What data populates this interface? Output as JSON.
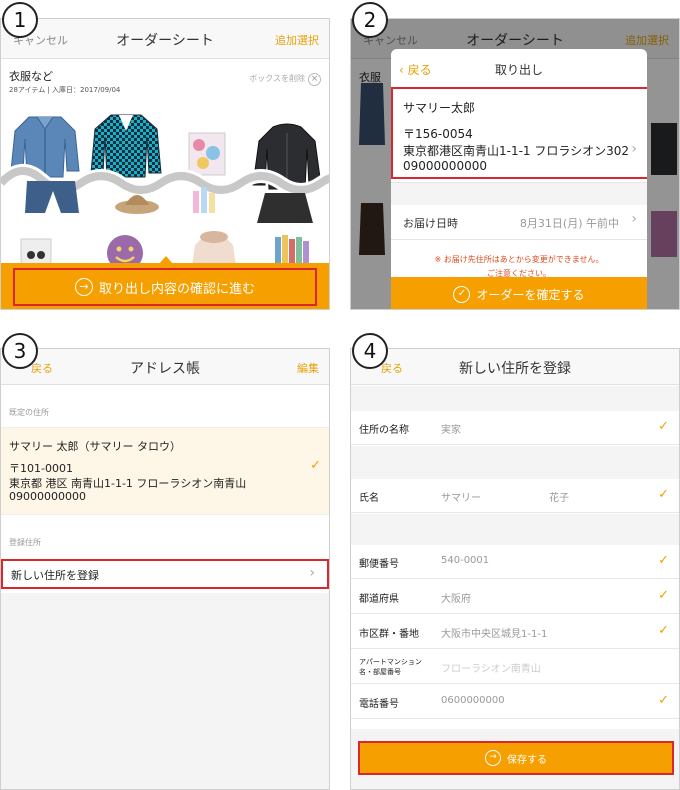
{
  "steps": [
    "1",
    "2",
    "3",
    "4"
  ],
  "screen1": {
    "nav": {
      "left": "キャンセル",
      "title": "オーダーシート",
      "right": "追加選択"
    },
    "box_title": "衣服など",
    "box_meta": "28アイテム | 入庫日：2017/09/04",
    "box_delete": "ボックスを削除",
    "cta": "取り出し内容の確認に進む"
  },
  "screen2": {
    "nav": {
      "left": "キャンセル",
      "title": "オーダーシート",
      "right": "追加選択"
    },
    "modal_back": "戻る",
    "modal_title": "取り出し",
    "address": {
      "name": "サマリー太郎",
      "zip": "〒156-0054",
      "line": "東京都港区南青山1-1-1 フロラシオン302",
      "phone": "09000000000"
    },
    "delivery_label": "お届け日時",
    "delivery_value": "8月31日(月) 午前中",
    "notice_1": "※ お届け先住所はあとから変更ができません。",
    "notice_2": "ご注意ください。",
    "confirm": "オーダーを確定する"
  },
  "screen3": {
    "nav": {
      "left": "戻る",
      "title": "アドレス帳",
      "right": "編集"
    },
    "default_section": "既定の住所",
    "default_address": {
      "name": "サマリー 太郎（サマリー タロウ）",
      "zip": "〒101-0001",
      "line": "東京都 港区 南青山1-1-1 フローラシオン南青山",
      "phone": "09000000000"
    },
    "registered_section": "登録住所",
    "new_address": "新しい住所を登録"
  },
  "screen4": {
    "nav": {
      "left": "戻る",
      "title": "新しい住所を登録"
    },
    "fields": {
      "address_name": {
        "label": "住所の名称",
        "value": "実家"
      },
      "name": {
        "label": "氏名",
        "last": "サマリー",
        "first": "花子"
      },
      "zip": {
        "label": "郵便番号",
        "value": "540-0001"
      },
      "prefecture": {
        "label": "都道府県",
        "value": "大阪府"
      },
      "city": {
        "label": "市区群・番地",
        "value": "大阪市中央区城見1-1-1"
      },
      "building": {
        "label_1": "アパートマンション",
        "label_2": "名・部屋番号",
        "value": "フローラシオン南青山"
      },
      "phone": {
        "label": "電話番号",
        "value": "0600000000"
      }
    },
    "save": "保存する"
  },
  "colors": {
    "accent": "#f5a000",
    "highlight": "#d8282e",
    "check": "#f0a000"
  }
}
